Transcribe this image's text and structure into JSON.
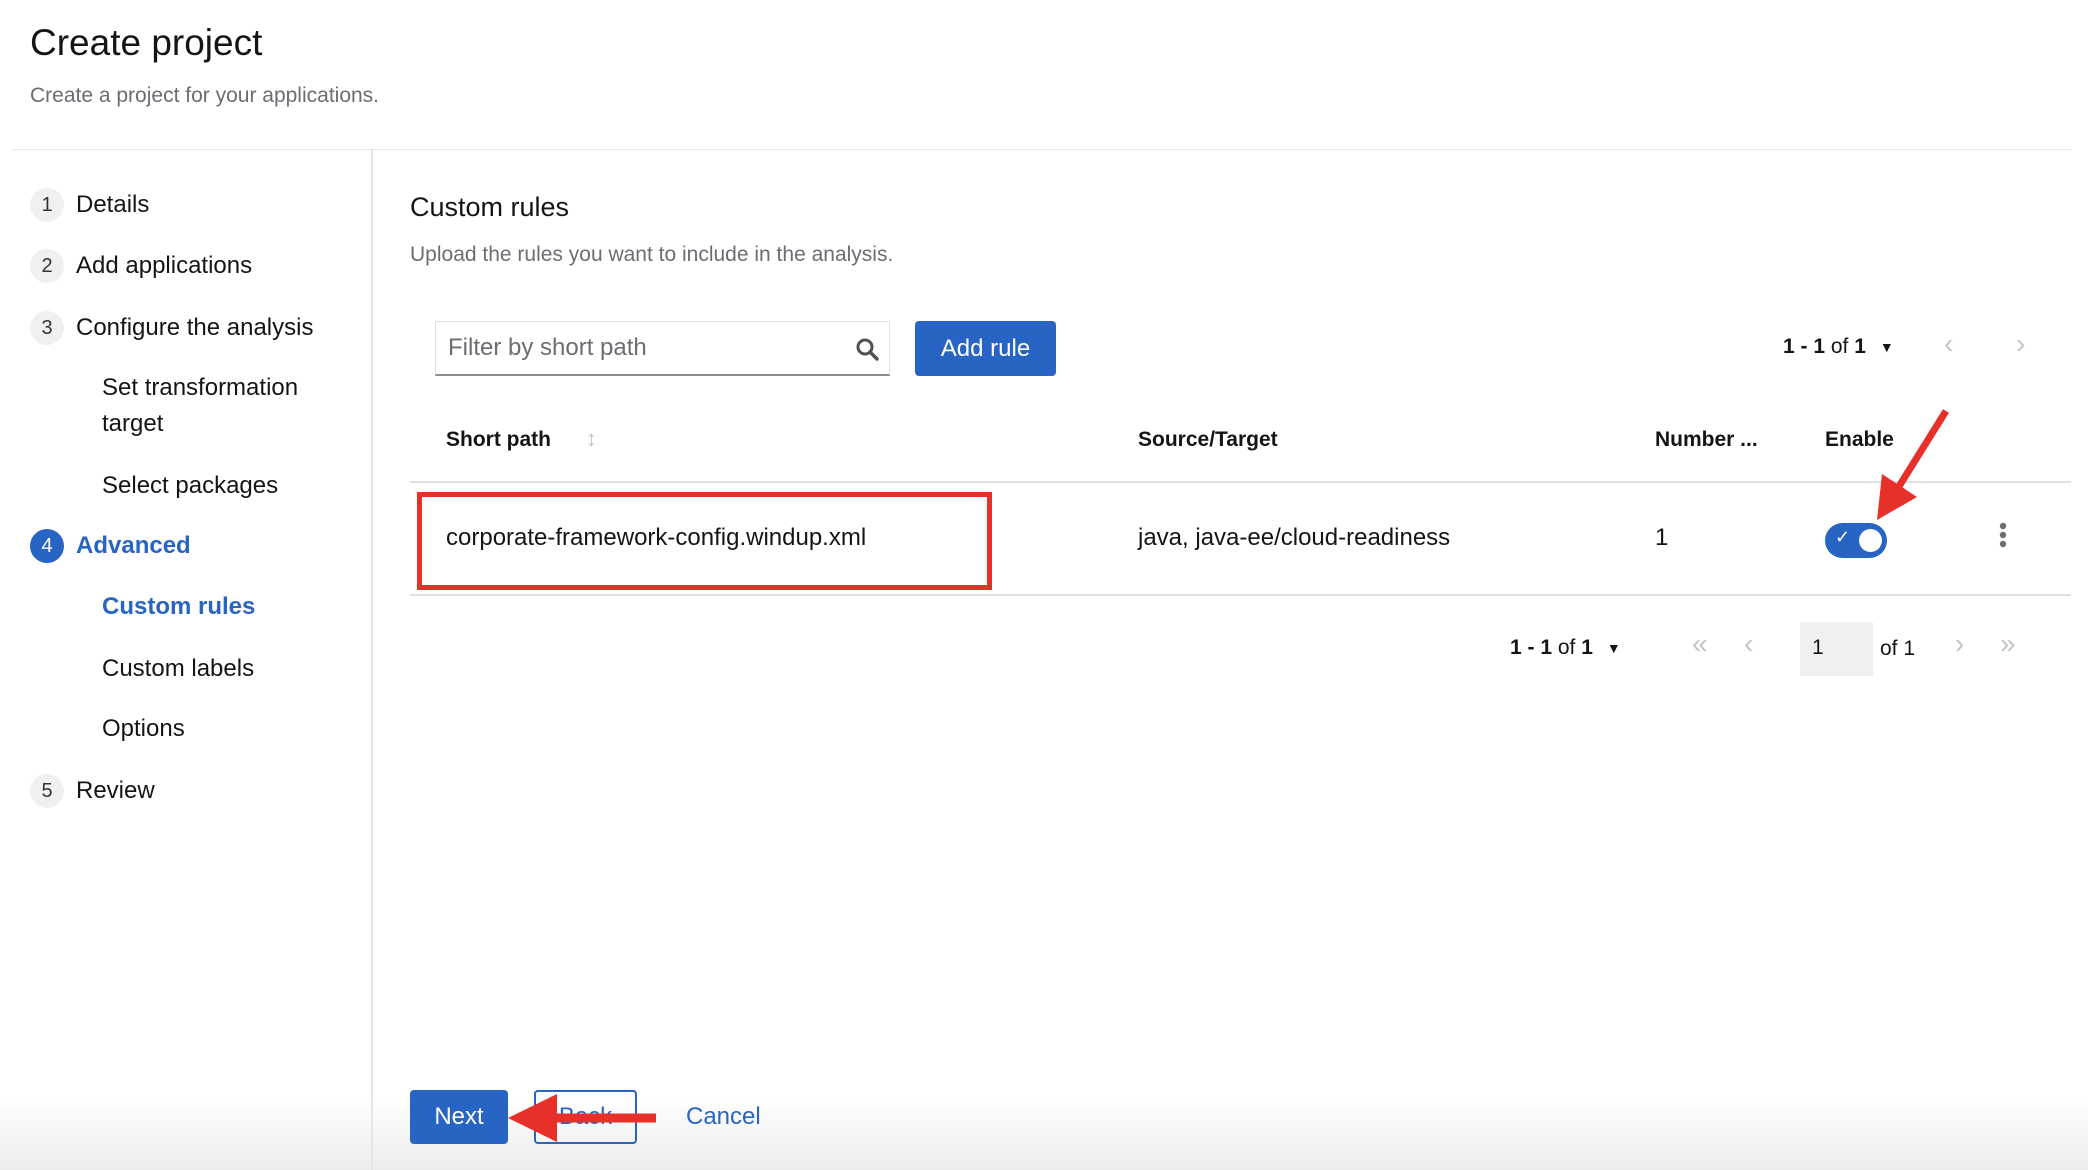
{
  "header": {
    "title": "Create project",
    "subtitle": "Create a project for your applications."
  },
  "wizard": {
    "steps": [
      {
        "num": "1",
        "label": "Details"
      },
      {
        "num": "2",
        "label": "Add applications"
      },
      {
        "num": "3",
        "label": "Configure the analysis",
        "substeps": [
          "Set transformation target",
          "Select packages"
        ]
      },
      {
        "num": "4",
        "label": "Advanced",
        "active": true,
        "substeps": [
          "Custom rules",
          "Custom labels",
          "Options"
        ]
      },
      {
        "num": "5",
        "label": "Review"
      }
    ]
  },
  "main": {
    "title": "Custom rules",
    "description": "Upload the rules you want to include in the analysis.",
    "search": {
      "placeholder": "Filter by short path",
      "icon": "search-icon"
    },
    "add_rule": "Add rule",
    "pagination_top": {
      "range": "1 - 1",
      "of": "of",
      "total": "1"
    },
    "table": {
      "columns": [
        "Short path",
        "Source/Target",
        "Number ...",
        "Enable"
      ],
      "rows": [
        {
          "short_path": "corporate-framework-config.windup.xml",
          "source_target": "java, java-ee/cloud-readiness",
          "number": "1",
          "enabled": true
        }
      ]
    },
    "pagination_bottom": {
      "range": "1 - 1",
      "of": "of",
      "total": "1",
      "page": "1",
      "of_pages": "of 1"
    }
  },
  "footer": {
    "next": "Next",
    "back": "Back",
    "cancel": "Cancel"
  },
  "colors": {
    "accent": "#2764c4",
    "annotation": "#e8302a"
  }
}
